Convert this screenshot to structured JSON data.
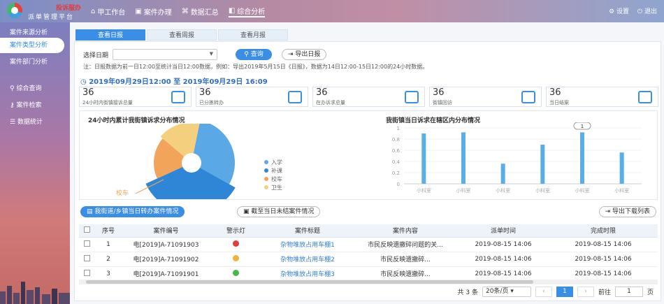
{
  "header": {
    "logo_top": "投诉服办",
    "logo_name": "派单管理平台",
    "nav": [
      {
        "label": "甲工作台",
        "active": false
      },
      {
        "label": "案件办理",
        "active": false
      },
      {
        "label": "数据汇总",
        "active": false
      },
      {
        "label": "综合分析",
        "active": true
      }
    ],
    "right": [
      {
        "label": "设置"
      },
      {
        "label": "退出"
      }
    ]
  },
  "sidebar": {
    "items": [
      {
        "label": "案件来源分析",
        "active": false
      },
      {
        "label": "案件类型分析",
        "active": true
      },
      {
        "label": "案件部门分析",
        "active": false
      },
      {
        "label": "综合查询",
        "active": false
      },
      {
        "label": "案件检索",
        "active": false
      },
      {
        "label": "数据统计",
        "active": false
      }
    ]
  },
  "tabs": [
    "查看日报",
    "查看周报",
    "查看月报"
  ],
  "filter": {
    "date_label": "选择日期",
    "query_label": "查询",
    "export_label": "导出日报"
  },
  "note": "注：日报数据为前一日12:00至统计当日12:00数据，例如：导出2019年5月15日《日报》，数据为14日12:00-15日12:00的24小时数据。",
  "range_text": "2019年09月29日12:00 至 2019年09月29日 16:09",
  "stats": [
    {
      "num": "36",
      "label": "24小时内街镇接诉总量",
      "icon": "users-icon"
    },
    {
      "num": "36",
      "label": "已分拣转办",
      "icon": "doc-icon"
    },
    {
      "num": "36",
      "label": "在办诉求总量",
      "icon": "bar-chart-icon"
    },
    {
      "num": "36",
      "label": "街镇回访",
      "icon": "chat-icon"
    },
    {
      "num": "36",
      "label": "当日结案",
      "icon": "mail-check-icon"
    }
  ],
  "pie_title": "24小时内累计我街镇诉求分布情况",
  "bar_title": "我街镇当日诉求在辖区内分布情况",
  "chart_data": [
    {
      "type": "pie",
      "title": "24小时内累计我街镇诉求分布情况",
      "categories": [
        "入学",
        "补课",
        "校车",
        "卫生"
      ],
      "values": [
        30,
        35,
        18,
        17
      ],
      "colors": [
        "#5aa9e6",
        "#2f86d6",
        "#f2a55a",
        "#f4cf7e"
      ],
      "annotation": "校车",
      "legend": "right"
    },
    {
      "type": "bar",
      "title": "我街镇当日诉求在辖区内分布情况",
      "categories": [
        "小科室",
        "小科室",
        "小科室",
        "小科室",
        "小科室",
        "小科室",
        "小科室",
        "小科室"
      ],
      "values": [
        0.9,
        0.92,
        0.36,
        0.7,
        0.92,
        0.56
      ],
      "x_ticks": [
        "小科室",
        "小科室",
        "小科室",
        "小科室",
        "小科室",
        "小科室"
      ],
      "yticks": [
        "0",
        "0.2",
        "0.4",
        "0.6",
        "0.8",
        "1"
      ],
      "ylim": [
        0,
        1
      ],
      "tooltip": "1",
      "color": "#5aaee6"
    }
  ],
  "table_tools": {
    "tab1": "我街道/乡镇当日转办案件情况",
    "tab2": "截至当日未结案件情况",
    "export": "导出下载列表"
  },
  "table": {
    "headers": [
      "序号",
      "案件编号",
      "警示灯",
      "案件标题",
      "案件内容",
      "派单时间",
      "完成时限"
    ],
    "rows": [
      {
        "no": "1",
        "code": "电[2019]A-71091903",
        "light": "#e53b3b",
        "title": "杂物堆放占用车棚1",
        "content": "市民反映遗撤碎问题的关...",
        "dispatch": "2019-08-15 14:06",
        "deadline": "2019-08-15 14:06"
      },
      {
        "no": "2",
        "code": "电[2019]A-71091902",
        "light": "#f2b233",
        "title": "杂物堆放占用车棚2",
        "content": "市民反映遗撤碎...",
        "dispatch": "2019-08-15 14:06",
        "deadline": "2019-08-15 14:06"
      },
      {
        "no": "3",
        "code": "电[2019]A-71091901",
        "light": "#46b84a",
        "title": "杂物堆放占用车棚3",
        "content": "市民反映遗撤碎...",
        "dispatch": "2019-08-15 14:06",
        "deadline": "2019-08-15 14:06"
      }
    ]
  },
  "pager": {
    "total": "共 3 条",
    "page_size": "20条/页",
    "current": "1",
    "goto_label": "前往",
    "goto_value": "1",
    "page_unit": "页"
  }
}
